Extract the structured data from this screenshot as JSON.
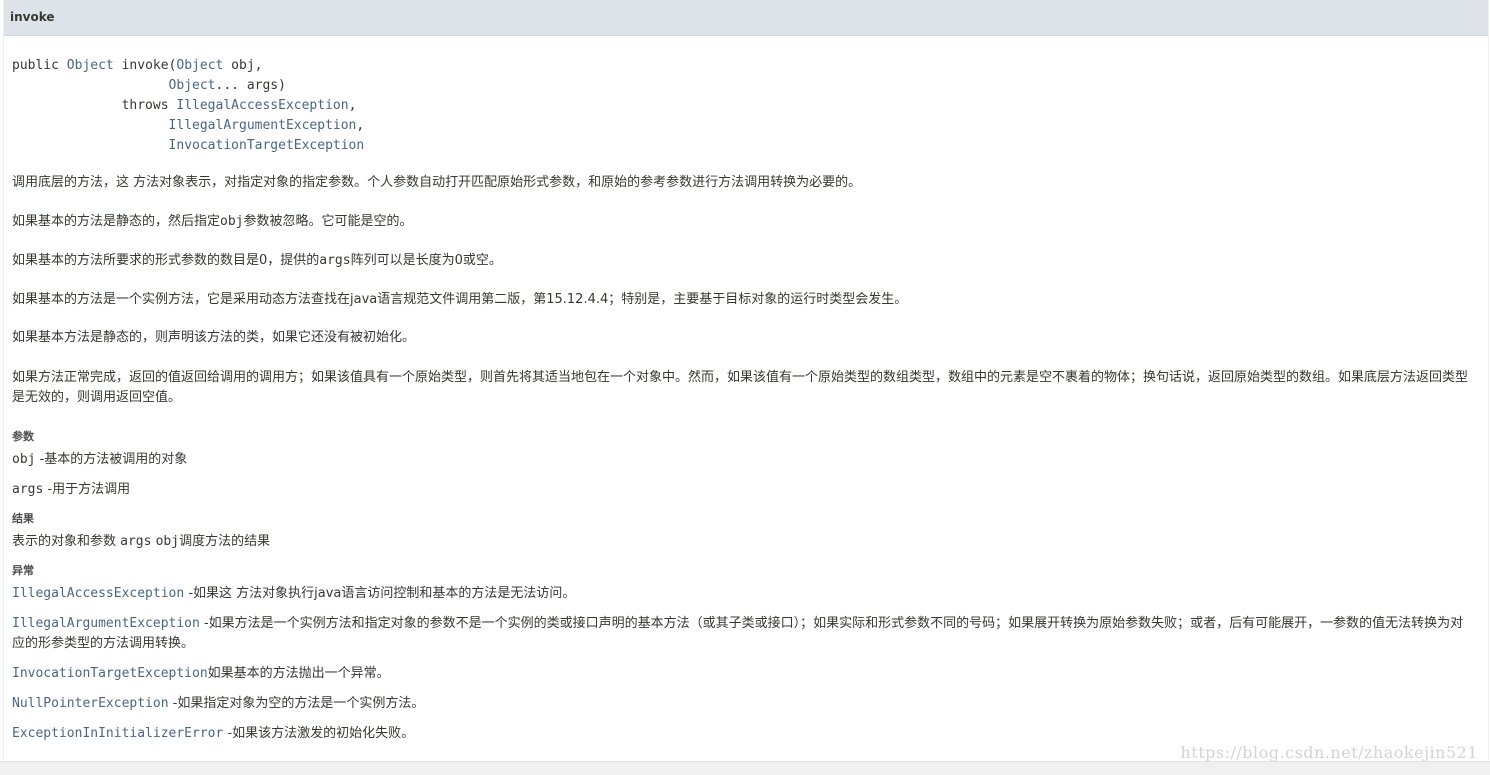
{
  "header": {
    "title": "invoke"
  },
  "signature": {
    "kw_public": "public ",
    "ret_type": "Object",
    "method": " invoke(",
    "p1_type": "Object",
    "p1_rest": " obj,",
    "indent1": "                    ",
    "p2_type": "Object",
    "p2_rest": "... args)",
    "throws": "              throws ",
    "ex1": "IllegalAccessException",
    "ex1_sep": ",",
    "indent2": "                    ",
    "ex2": "IllegalArgumentException",
    "ex2_sep": ",",
    "indent3": "                    ",
    "ex3": "InvocationTargetException"
  },
  "description": {
    "p1": "调用底层的方法，这 方法对象表示，对指定对象的指定参数。个人参数自动打开匹配原始形式参数，和原始的参考参数进行方法调用转换为必要的。",
    "p2_pre": "如果基本的方法是静态的，然后指定",
    "p2_code": "obj",
    "p2_post": "参数被忽略。它可能是空的。",
    "p3_pre": "如果基本的方法所要求的形式参数的数目是0，提供的",
    "p3_code": "args",
    "p3_post": "阵列可以是长度为0或空。",
    "p4": "如果基本的方法是一个实例方法，它是采用动态方法查找在java语言规范文件调用第二版，第15.12.4.4；特别是，主要基于目标对象的运行时类型会发生。",
    "p5": "如果基本方法是静态的，则声明该方法的类，如果它还没有被初始化。",
    "p6": "如果方法正常完成，返回的值返回给调用的调用方；如果该值具有一个原始类型，则首先将其适当地包在一个对象中。然而，如果该值有一个原始类型的数组类型，数组中的元素是空不裹着的物体；换句话说，返回原始类型的数组。如果底层方法返回类型是无效的，则调用返回空值。"
  },
  "params": {
    "label": "参数",
    "items": [
      {
        "name": "obj",
        "desc": " -基本的方法被调用的对象"
      },
      {
        "name": "args",
        "desc": " -用于方法调用"
      }
    ]
  },
  "returns": {
    "label": "结果",
    "pre": "表示的对象和参数 ",
    "code1": "args",
    "mid": " ",
    "code2": "obj",
    "post": "调度方法的结果"
  },
  "throws": {
    "label": "异常",
    "items": [
      {
        "name": "IllegalAccessException",
        "desc": " -如果这 方法对象执行java语言访问控制和基本的方法是无法访问。"
      },
      {
        "name": "IllegalArgumentException",
        "desc": " -如果方法是一个实例方法和指定对象的参数不是一个实例的类或接口声明的基本方法（或其子类或接口）；如果实际和形式参数不同的号码；如果展开转换为原始参数失败；或者，后有可能展开，一参数的值无法转换为对应的形参类型的方法调用转换。"
      },
      {
        "name": "InvocationTargetException",
        "desc": "如果基本的方法抛出一个异常。"
      },
      {
        "name": "NullPointerException",
        "desc": " -如果指定对象为空的方法是一个实例方法。"
      },
      {
        "name": "ExceptionInInitializerError",
        "desc": " -如果该方法激发的初始化失败。"
      }
    ]
  },
  "watermark": "https://blog.csdn.net/zhaokejin521",
  "colors": {
    "header_bg": "#dee3e9",
    "link": "#4a6782",
    "text": "#353833"
  }
}
